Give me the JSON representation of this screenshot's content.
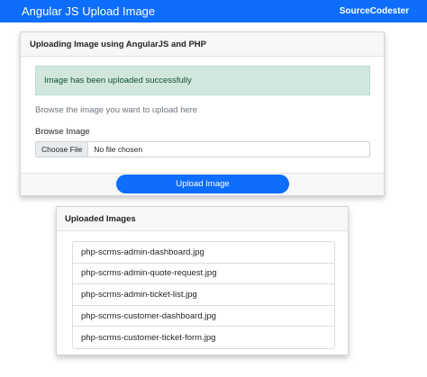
{
  "navbar": {
    "brand": "Angular JS Upload Image",
    "right_text": "SourceCodester"
  },
  "upload_card": {
    "title": "Uploading Image using AngularJS and PHP",
    "alert_message": "Image has been uploaded successfully",
    "help_text": "Browse the image you want to upload here",
    "field_label": "Browse Image",
    "choose_file_label": "Choose File",
    "no_file_text": "No file chosen",
    "upload_button_label": "Upload Image"
  },
  "uploaded_card": {
    "title": "Uploaded Images",
    "items": [
      "php-scrms-admin-dashboard.jpg",
      "php-scrms-admin-quote-request.jpg",
      "php-scrms-admin-ticket-list.jpg",
      "php-scrms-customer-dashboard.jpg",
      "php-scrms-customer-ticket-form.jpg"
    ]
  },
  "colors": {
    "primary": "#0d6efd",
    "success_bg": "#d1e7dd",
    "success_text": "#0f5132"
  }
}
